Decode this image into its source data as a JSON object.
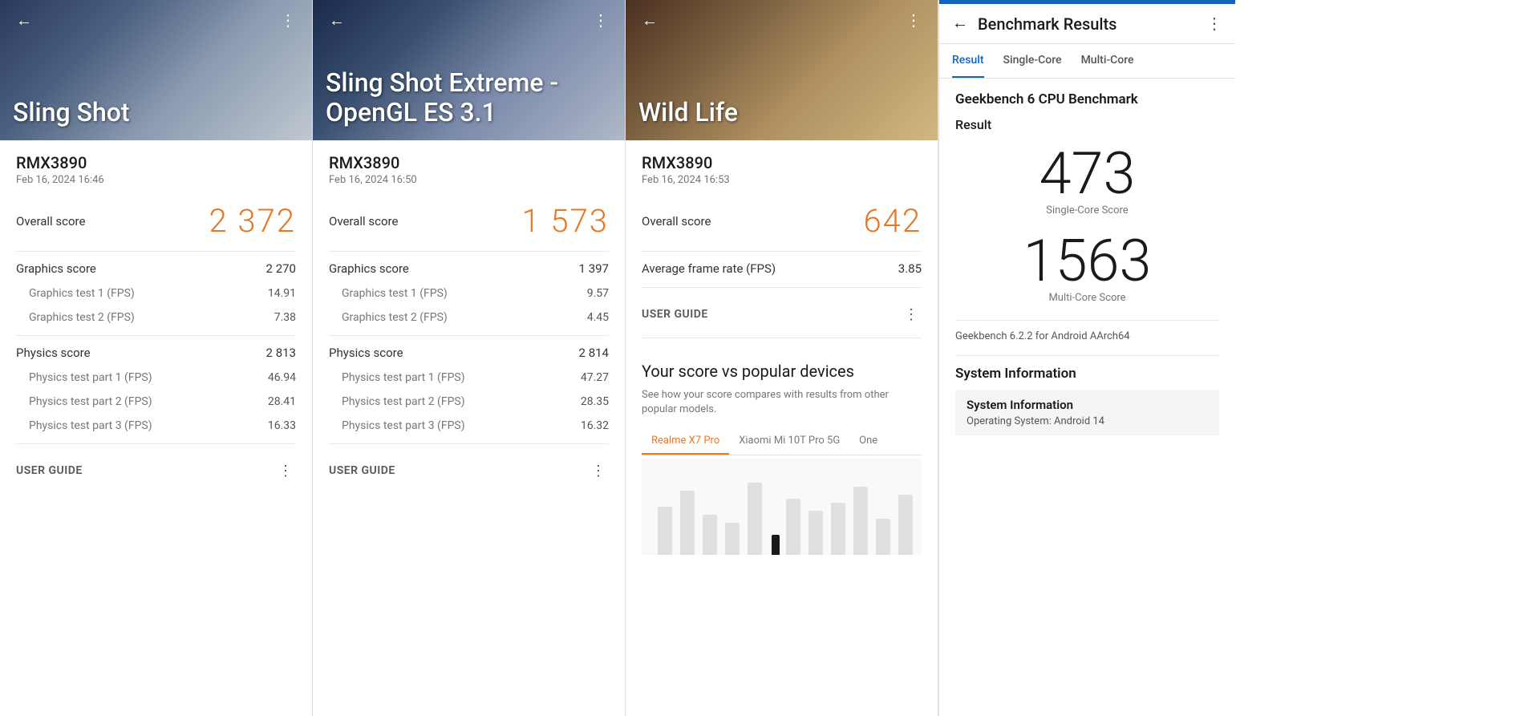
{
  "panel1": {
    "title": "Sling Shot",
    "device": "RMX3890",
    "date": "Feb 16, 2024 16:46",
    "overall_label": "Overall score",
    "overall_value": "2 372",
    "graphics_label": "Graphics score",
    "graphics_value": "2 270",
    "gt1_label": "Graphics test 1 (FPS)",
    "gt1_value": "14.91",
    "gt2_label": "Graphics test 2 (FPS)",
    "gt2_value": "7.38",
    "physics_label": "Physics score",
    "physics_value": "2 813",
    "pt1_label": "Physics test part 1 (FPS)",
    "pt1_value": "46.94",
    "pt2_label": "Physics test part 2 (FPS)",
    "pt2_value": "28.41",
    "pt3_label": "Physics test part 3 (FPS)",
    "pt3_value": "16.33",
    "user_guide": "USER GUIDE"
  },
  "panel2": {
    "title": "Sling Shot Extreme - OpenGL ES 3.1",
    "device": "RMX3890",
    "date": "Feb 16, 2024 16:50",
    "overall_label": "Overall score",
    "overall_value": "1 573",
    "graphics_label": "Graphics score",
    "graphics_value": "1 397",
    "gt1_label": "Graphics test 1 (FPS)",
    "gt1_value": "9.57",
    "gt2_label": "Graphics test 2 (FPS)",
    "gt2_value": "4.45",
    "physics_label": "Physics score",
    "physics_value": "2 814",
    "pt1_label": "Physics test part 1 (FPS)",
    "pt1_value": "47.27",
    "pt2_label": "Physics test part 2 (FPS)",
    "pt2_value": "28.35",
    "pt3_label": "Physics test part 3 (FPS)",
    "pt3_value": "16.32",
    "user_guide": "USER GUIDE"
  },
  "panel3": {
    "title": "Wild Life",
    "device": "RMX3890",
    "date": "Feb 16, 2024 16:53",
    "overall_label": "Overall score",
    "overall_value": "642",
    "fps_label": "Average frame rate (FPS)",
    "fps_value": "3.85",
    "user_guide": "USER GUIDE",
    "comparison_title": "Your score vs popular devices",
    "comparison_sub": "See how your score compares with results from other popular models.",
    "tab1": "Realme X7 Pro",
    "tab2": "Xiaomi Mi 10T Pro 5G",
    "tab3": "One"
  },
  "panel_geekbench": {
    "title": "Benchmark Results",
    "back": "←",
    "dots": "⋮",
    "tabs": [
      "Result",
      "Single-Core",
      "Multi-Core"
    ],
    "active_tab": "Result",
    "section_title": "Geekbench 6 CPU Benchmark",
    "sub_title": "Result",
    "single_score": "473",
    "single_label": "Single-Core Score",
    "multi_score": "1563",
    "multi_label": "Multi-Core Score",
    "version": "Geekbench 6.2.2 for Android AArch64",
    "system_section": "System Information",
    "system_label": "System Information",
    "system_sub": "Operating System: Android 14"
  }
}
